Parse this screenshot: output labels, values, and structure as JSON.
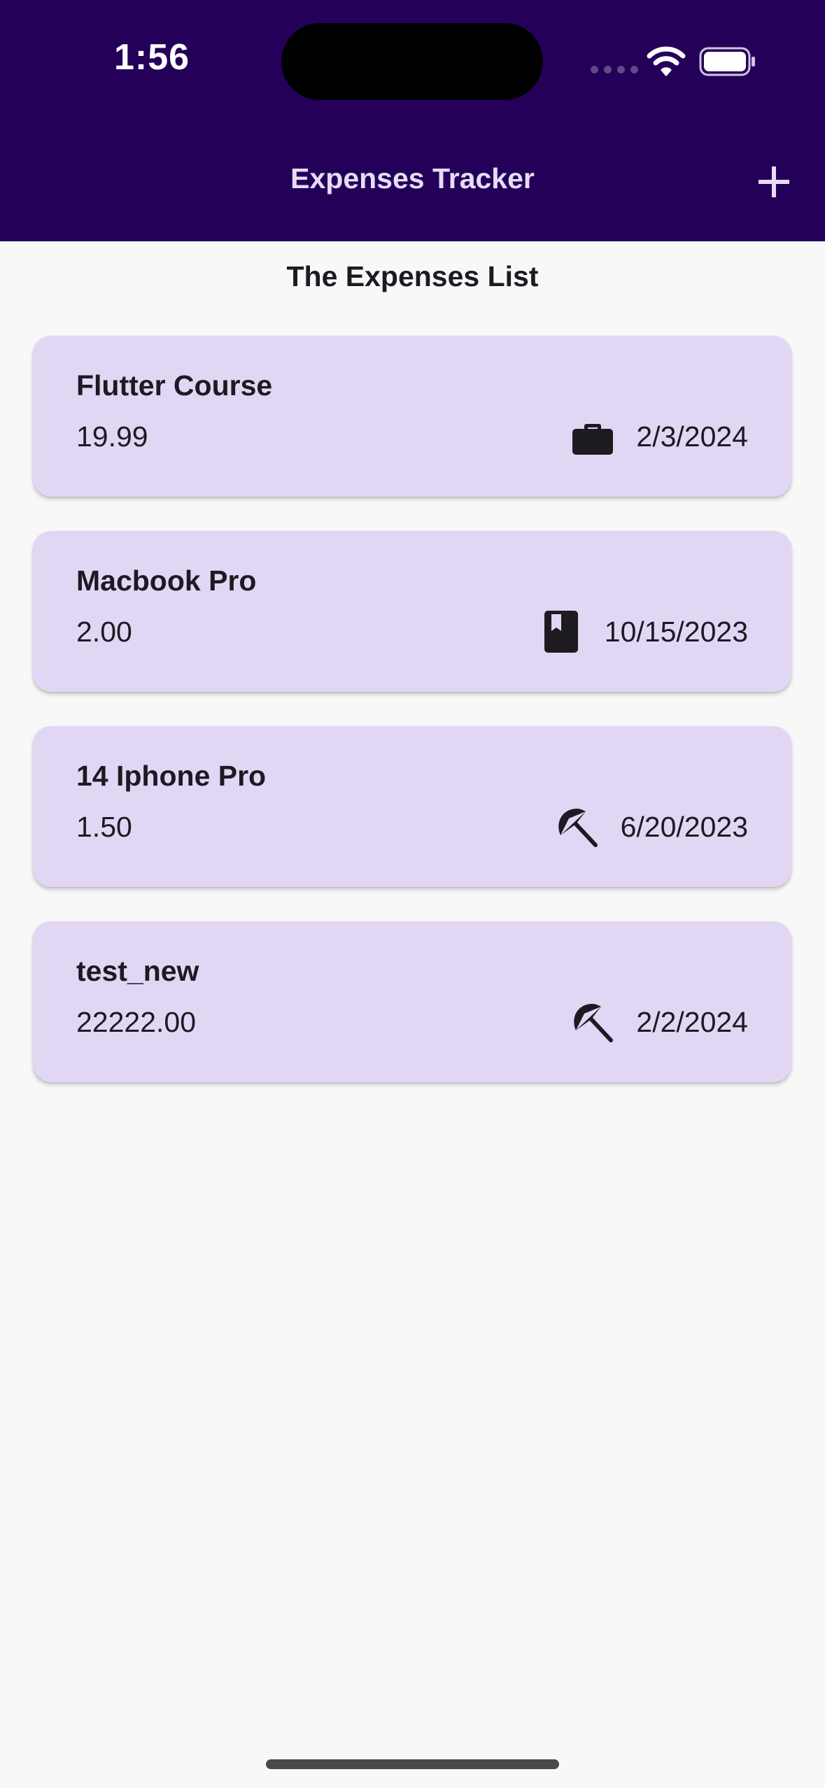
{
  "status_bar": {
    "time": "1:56",
    "icons": [
      "cellular-signal-icon",
      "wifi-icon",
      "battery-icon"
    ]
  },
  "app_bar": {
    "title": "Expenses Tracker",
    "add_icon": "plus-icon",
    "background_color": "#240059",
    "title_color": "#e6dcf5"
  },
  "list": {
    "title": "The Expenses List",
    "card_color": "#e1d7f5",
    "items": [
      {
        "title": "Flutter Course",
        "amount": "19.99",
        "category_icon": "briefcase-icon",
        "date": "2/3/2024"
      },
      {
        "title": "Macbook Pro",
        "amount": "2.00",
        "category_icon": "book-icon",
        "date": "10/15/2023"
      },
      {
        "title": "14 Iphone Pro",
        "amount": "1.50",
        "category_icon": "beach-umbrella-icon",
        "date": "6/20/2023"
      },
      {
        "title": "test_new",
        "amount": "22222.00",
        "category_icon": "beach-umbrella-icon",
        "date": "2/2/2024"
      }
    ]
  }
}
